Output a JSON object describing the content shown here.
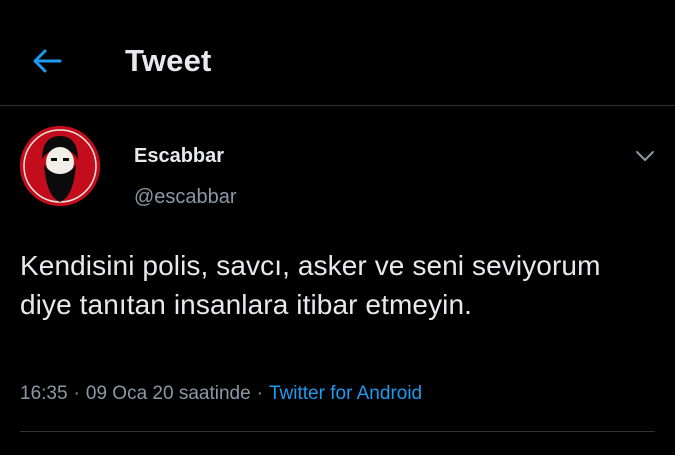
{
  "header": {
    "title": "Tweet",
    "back_icon": "arrow-left-icon"
  },
  "tweet": {
    "author_name": "Escabbar",
    "author_handle": "@escabbar",
    "text": "Kendisini polis, savcı, asker ve seni seviyorum diye tanıtan insanlara itibar etmeyin.",
    "time": "16:35",
    "date": "09 Oca 20 saatinde",
    "separator": "·",
    "source": "Twitter for Android",
    "menu_icon": "chevron-down-icon"
  },
  "colors": {
    "background": "#000000",
    "accent": "#1d9bf0",
    "text": "#e7e9ea",
    "secondary": "#8b98a5",
    "avatar_bg": "#c40d1c"
  }
}
